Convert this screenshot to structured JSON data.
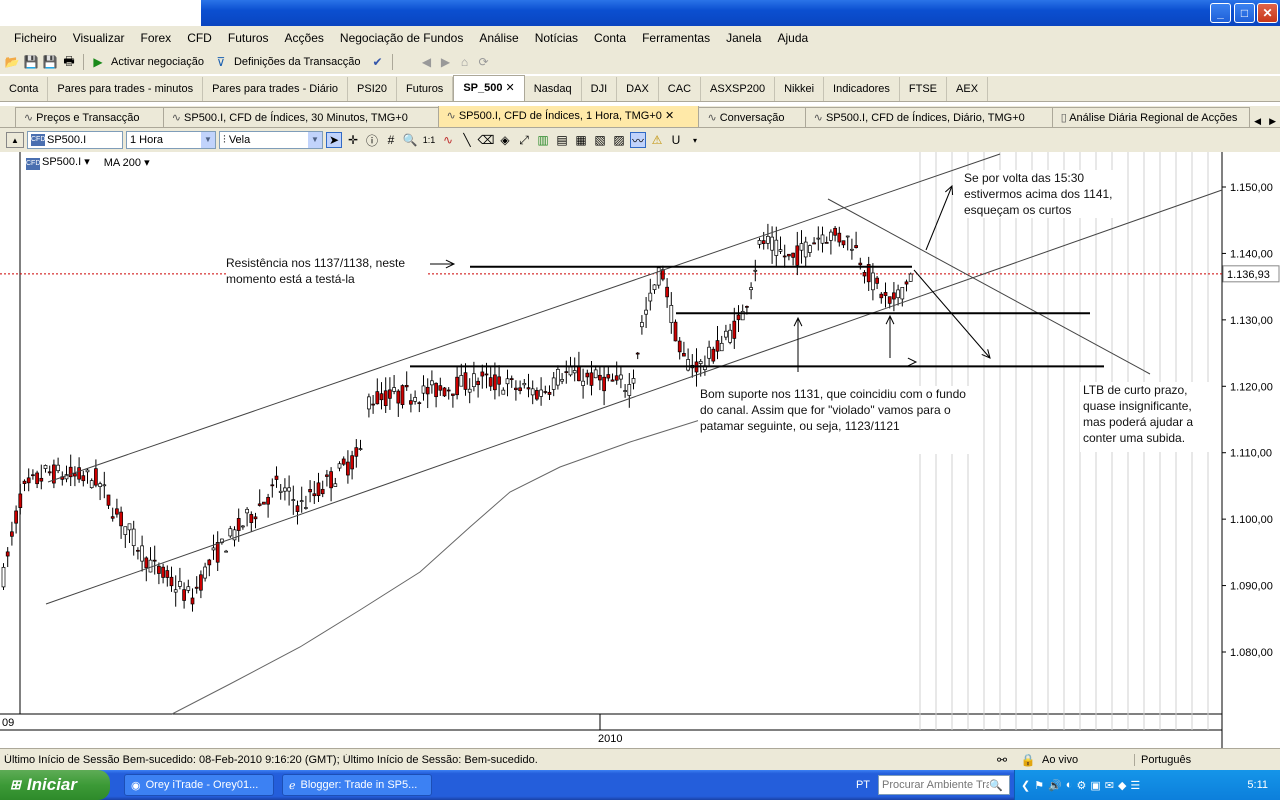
{
  "window": {
    "minimize": "_",
    "maximize": "□",
    "close": "✕"
  },
  "menu": [
    "Ficheiro",
    "Visualizar",
    "Forex",
    "CFD",
    "Futuros",
    "Acções",
    "Negociação de Fundos",
    "Análise",
    "Notícias",
    "Conta",
    "Ferramentas",
    "Janela",
    "Ajuda"
  ],
  "toolbar": {
    "activate": "Activar negociação",
    "settings": "Definições da Transacção"
  },
  "market_tabs": [
    "Conta",
    "Pares para trades - minutos",
    "Pares para trades - Diário",
    "PSI20",
    "Futuros",
    "SP_500",
    "Nasdaq",
    "DJI",
    "DAX",
    "CAC",
    "ASXSP200",
    "Nikkei",
    "Indicadores",
    "FTSE",
    "AEX"
  ],
  "market_tab_active": "SP_500",
  "window_tabs": [
    {
      "label": "Preços e Transacção",
      "active": false
    },
    {
      "label": "SP500.I, CFD de Índices, 30 Minutos, TMG+0",
      "active": false
    },
    {
      "label": "SP500.I, CFD de Índices, 1 Hora, TMG+0",
      "active": true
    },
    {
      "label": "Conversação",
      "active": false
    },
    {
      "label": "SP500.I, CFD de Índices, Diário, TMG+0",
      "active": false
    },
    {
      "label": "Análise Diária Regional de Acções",
      "active": false
    }
  ],
  "chart_toolbar": {
    "symbol": "SP500.I",
    "timeframe": "1 Hora",
    "chart_type": "Vela"
  },
  "chart_header": {
    "symbol": "SP500.I",
    "indicator": "MA 200"
  },
  "price_axis": [
    "1.150,00",
    "1.140,00",
    "1.130,00",
    "1.120,00",
    "1.110,00",
    "1.100,00",
    "1.090,00",
    "1.080,00"
  ],
  "current_price": "1.136,93",
  "time_axis": {
    "left_label": "09",
    "year_label": "2010"
  },
  "annotations": {
    "resistance": "Resistência nos 1137/1138, neste momento está a testá-la",
    "above": "Se por volta das 15:30 estivermos acima dos 1141, esqueçam os curtos",
    "support": "Bom suporte nos 1131, que coincidiu com o fundo do canal. Assim que for \"violado\" vamos para o patamar seguinte, ou seja, 1123/1121",
    "ltb": "LTB de curto prazo, quase insignificante, mas poderá ajudar a conter uma subida."
  },
  "status": {
    "message": "Último Início de Sessão Bem-sucedido: 08-Feb-2010 9:16:20 (GMT); Último Início de Sessão: Bem-sucedido.",
    "live": "Ao vivo",
    "language": "Português"
  },
  "taskbar": {
    "start": "Iniciar",
    "tasks": [
      "Orey iTrade - Orey01...",
      "Blogger: Trade in SP5..."
    ],
    "lang": "PT",
    "search_placeholder": "Procurar Ambiente Tra",
    "clock": "5:11"
  },
  "colors": {
    "current_price_line": "#cc0000",
    "candle_up": "#ffffff",
    "candle_down": "#cc0000"
  }
}
